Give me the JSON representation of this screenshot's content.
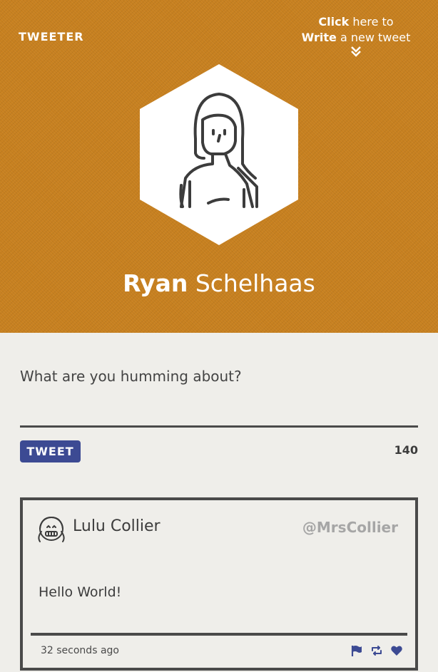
{
  "app": {
    "logo": "TWEETER"
  },
  "compose_hint": {
    "line1_bold": "Click",
    "line1_rest": " here to",
    "line2_bold": "Write",
    "line2_rest": " a new tweet",
    "icon": "chevron-double-down-icon"
  },
  "profile": {
    "first_name": "Ryan",
    "last_name": " Schelhaas",
    "avatar_icon": "girl-avatar-icon"
  },
  "composer": {
    "placeholder": "What are you humming about?",
    "value": ""
  },
  "tweet_button": {
    "label": "TWEET"
  },
  "char_count": "140",
  "feed": [
    {
      "author_name": "Lulu Collier",
      "handle": "@MrsCollier",
      "text": "Hello World!",
      "timestamp": "32 seconds ago",
      "avatar_icon": "girl-braces-avatar-icon",
      "actions": [
        "flag-icon",
        "retweet-icon",
        "heart-icon"
      ]
    }
  ],
  "colors": {
    "hero": "#c7801f",
    "background": "#efeeea",
    "accent": "#3c4a93",
    "border": "#4a4a4a",
    "muted": "#a6a6a6"
  }
}
